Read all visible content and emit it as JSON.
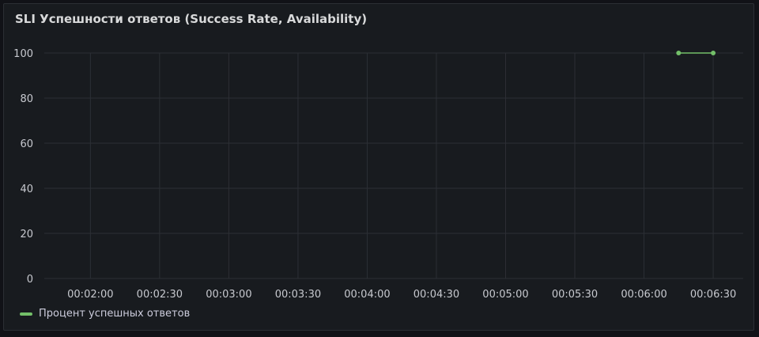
{
  "panel": {
    "title": "SLI Успешности ответов (Success Rate, Availability)"
  },
  "colors": {
    "background": "#181b1f",
    "grid": "#2c2f35",
    "series": "#73bf69",
    "text": "#c7c9cf"
  },
  "chart_data": {
    "type": "line",
    "title": "SLI Успешности ответов (Success Rate, Availability)",
    "xlabel": "",
    "ylabel": "",
    "grid": true,
    "legend_position": "bottom-left",
    "x_ticks": [
      "00:02:00",
      "00:02:30",
      "00:03:00",
      "00:03:30",
      "00:04:00",
      "00:04:30",
      "00:05:00",
      "00:05:30",
      "00:06:00",
      "00:06:30"
    ],
    "y_ticks": [
      0,
      20,
      40,
      60,
      80,
      100
    ],
    "ylim": [
      0,
      100
    ],
    "xlim": [
      "00:01:40",
      "00:06:43"
    ],
    "series": [
      {
        "name": "Процент успешных ответов",
        "color": "#73bf69",
        "x": [
          "00:06:15",
          "00:06:30"
        ],
        "y": [
          100,
          100
        ]
      }
    ]
  }
}
